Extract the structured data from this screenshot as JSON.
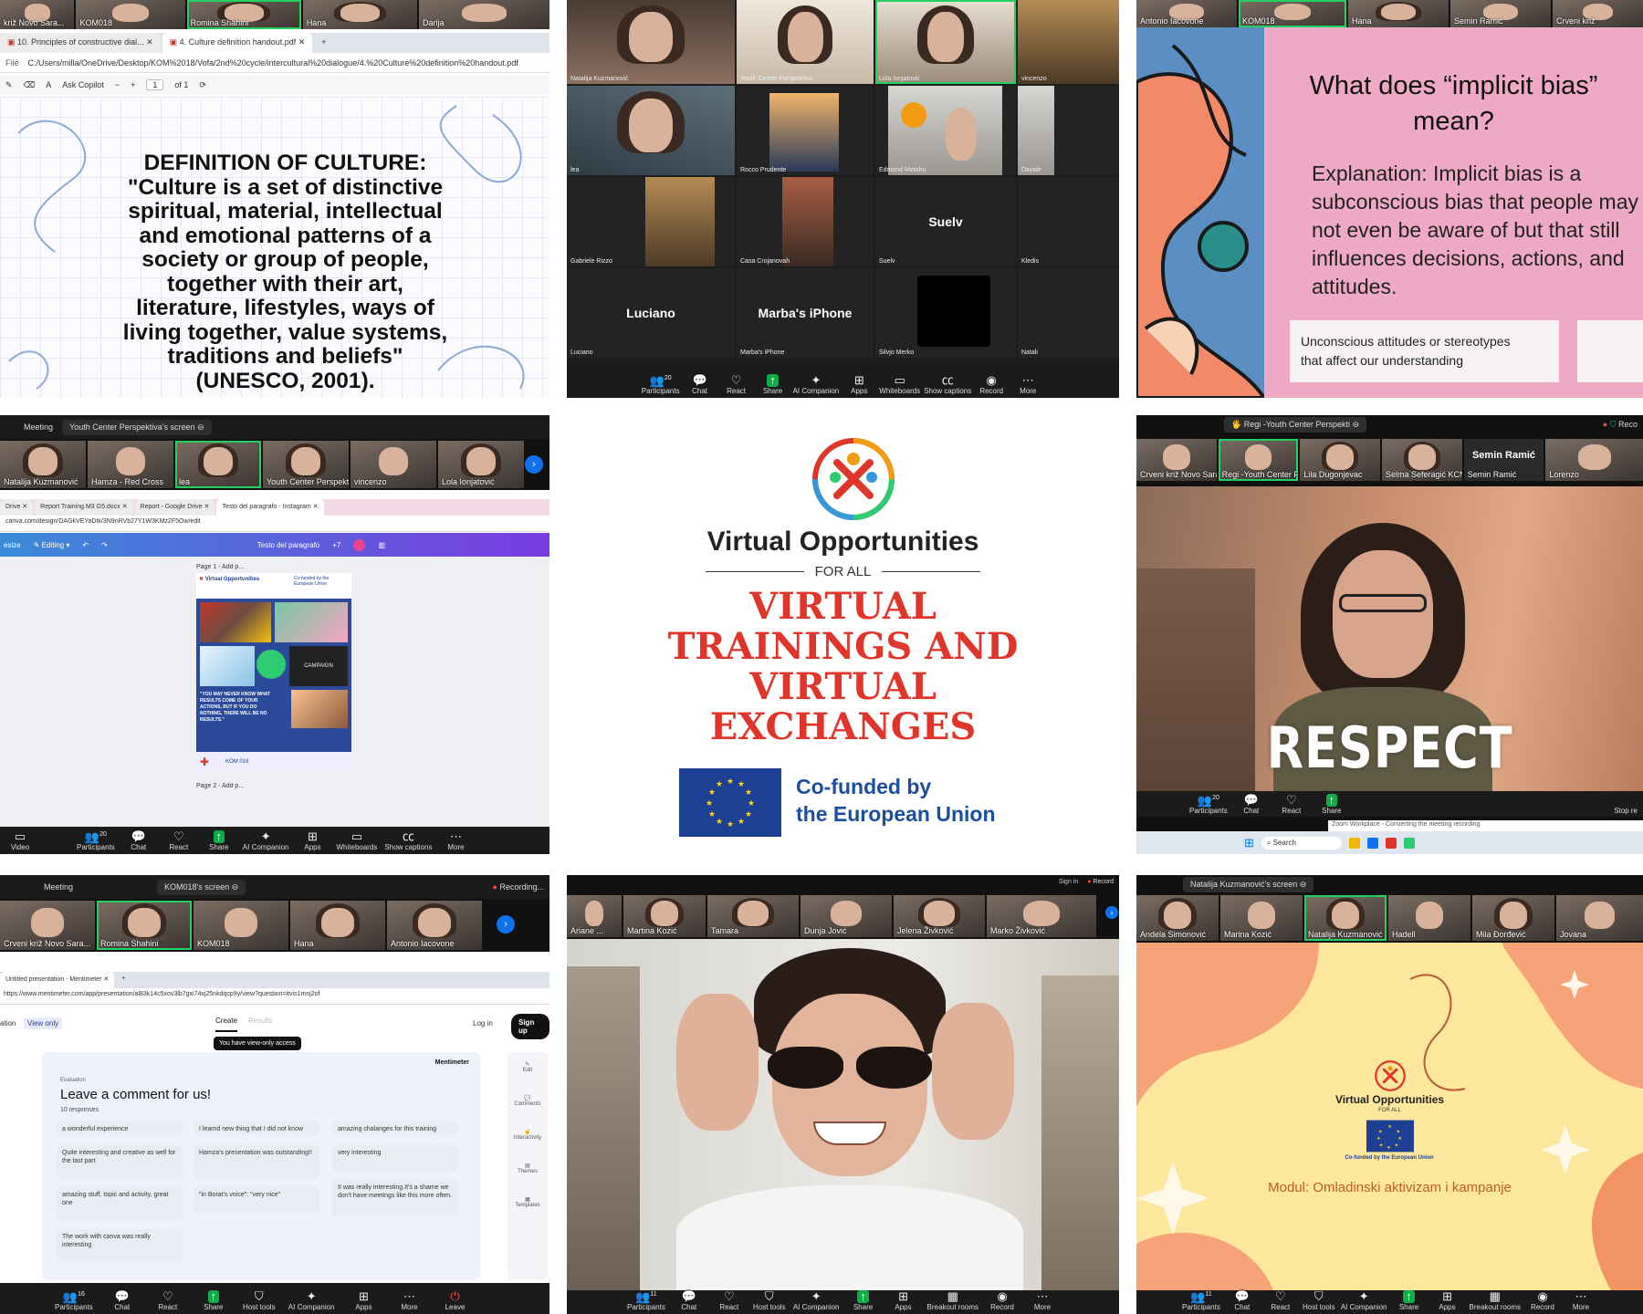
{
  "t1": {
    "participants": [
      "križ Novo Sara...",
      "KOM018",
      "Romina Shahini",
      "Hana",
      "Darija"
    ],
    "tabs": [
      "10. Principles of constructive dial...",
      "4. Culture definition handout.pdf"
    ],
    "address_label": "File",
    "address": "C:/Users/milla/OneDrive/Desktop/KOM%2018/Vofa/2nd%20cycle/intercultural%20dialogue/4.%20Culture%20definition%20handout.pdf",
    "toolbar": {
      "copilot": "Ask Copilot",
      "page": "1",
      "of": "of 1",
      "minus": "−",
      "plus": "+"
    },
    "slide_lines": [
      "DEFINITION OF CULTURE:",
      "\"Culture is a set of distinctive",
      "spiritual, material, intellectual",
      "and emotional patterns of a",
      "society or group of people,",
      "together with their art,",
      "literature, lifestyles, ways of",
      "living together, value systems,",
      "traditions and beliefs\"",
      "(UNESCO, 2001)."
    ]
  },
  "t2": {
    "cells": [
      "Natalija Kuzmanović",
      "Youth Center Perspektiva",
      "Lola Ionjatović",
      "vincenzo",
      "lea",
      "Rocco Prudente",
      "Edmond Metohu",
      "Davide",
      "Gabriele Rizzo",
      "Casa Crojanovah",
      "Suelv",
      "Kledis",
      "Luciano",
      "Marba's iPhone",
      "Silvjo Merko",
      "Natali"
    ],
    "big": {
      "suelv": "Suelv",
      "luciano": "Luciano",
      "marba": "Marba's iPhone"
    },
    "count": "20",
    "bar": [
      "Participants",
      "Chat",
      "React",
      "Share",
      "AI Companion",
      "Apps",
      "Whiteboards",
      "Show captions",
      "Record",
      "More"
    ]
  },
  "t3": {
    "participants": [
      "Antonio Iacovone",
      "KOM018",
      "Hana",
      "Semin Ramić",
      "Crveni križ"
    ],
    "title_lines": [
      "What does “implicit bias”",
      "mean?"
    ],
    "explanation_lines": [
      "Explanation: Implicit bias is a",
      "subconscious bias that people may",
      "not even be aware of but that still",
      "influences decisions, actions, and",
      "attitudes."
    ],
    "card_lines": [
      "Unconscious attitudes or stereotypes",
      "that affect our understanding"
    ]
  },
  "t4": {
    "header": {
      "meeting": "Meeting",
      "screen": "Youth Center Perspektiva's screen"
    },
    "participants": [
      "Natalija Kuzmanović",
      "Hamza - Red Cross",
      "lea",
      "Youth Center Perspekti...",
      "vincenzo",
      "Lola Ionjatović"
    ],
    "tabs": [
      "Drive",
      "Report Training M3 G5.docx",
      "Report - Google Drive",
      "Testo del paragrafo - Instagram"
    ],
    "address": "canva.com/design/DAGkVEYaDtk/3N9nRVb27Y1W3KMz2F5Ow/edit",
    "editor": {
      "resize": "esize",
      "editing": "Editing",
      "text": "Testo del paragrafo",
      "more": "+7"
    },
    "page1": "Page 1 - Add p...",
    "page2": "Page 2 - Add p...",
    "poster": {
      "title": "Virtual Opportunities",
      "eu": "Co-funded by the European Union",
      "quote": "\"YOU MAY NEVER KNOW WHAT RESULTS COME OF YOUR ACTIONS, BUT IF YOU DO NOTHING, THERE WILL BE NO RESULTS.\"",
      "campaign": "CAMPAIGN",
      "logos": "KOM 018"
    },
    "count": "20",
    "bar": [
      "Video",
      "Participants",
      "Chat",
      "React",
      "Share",
      "AI Companion",
      "Apps",
      "Whiteboards",
      "Show captions",
      "More"
    ]
  },
  "t5": {
    "title": "Virtual Opportunities",
    "subtitle": "FOR ALL",
    "headline": [
      "VIRTUAL",
      "TRAININGS AND",
      "VIRTUAL",
      "EXCHANGES"
    ],
    "eu_lines": [
      "Co-funded by",
      "the European Union"
    ]
  },
  "t6": {
    "screen": "Regi -Youth Center Perspekti",
    "rec": "Reco",
    "participants": [
      "Crveni križ Novo Sara...",
      "Regi -Youth Center Perspe...",
      "Lila Dugonjevac",
      "Selma Seferagić KCNS",
      "Semin Ramić",
      "Lorenzo"
    ],
    "big_name": "Semin Ramić",
    "overlay": "RESPECT",
    "count": "20",
    "bar": [
      "Participants",
      "Chat",
      "React",
      "Share"
    ],
    "notification": "Zoom Workplace - Converting the meeting recording",
    "stop": "Stop re",
    "search": "Search"
  },
  "t7": {
    "header": {
      "meeting": "Meeting",
      "screen": "KOM018's screen",
      "rec": "Recording..."
    },
    "participants": [
      "Crveni križ Novo Sara...",
      "Romina Shahini",
      "KOM018",
      "Hana",
      "Antonio Iacovone"
    ],
    "tab": "Untitled presentation - Mentimeter",
    "address": "https://www.mentimeter.com/app/presentation/al83k14c5xov3lb7gxi74xj25nkdqcp9y/view?question=itvis1mnj2of",
    "nav": {
      "left": "ation",
      "viewonly": "View only",
      "create": "Create",
      "results": "Results",
      "login": "Log in",
      "signup": "Sign up"
    },
    "tooltip": "You have view-only access",
    "brand": "Mentimeter",
    "eval": "Evaluation",
    "question": "Leave a comment for us!",
    "responses": "10 responses",
    "comments": [
      "a wonderful experience",
      "I learnd new thing that I did not know",
      "amazing chalanges for this training",
      "Quite interesting and creative as well for the last part",
      "Hamza's presentation was outstanding!!",
      "very interesting",
      "amazing stuff, topic and activity, great one",
      "\"in Borat's voice\": \"very nice\"",
      "It was really interesting.It's a shame we don't have meetings like this more often.",
      "The work with canva was really interesting"
    ],
    "side": [
      "Edit",
      "Comments",
      "Interactivity",
      "Themes",
      "Templates"
    ],
    "count": "16",
    "bar": [
      "Participants",
      "Chat",
      "React",
      "Share",
      "Host tools",
      "AI Companion",
      "Apps",
      "More",
      "Leave"
    ]
  },
  "t8": {
    "top": {
      "signin": "Sign in",
      "rec": "Record"
    },
    "participants": [
      "Ariane ...",
      "Martina Kozić",
      "Tamara",
      "Dunja Jović",
      "Jelena Živković",
      "Marko Živković"
    ],
    "count": "11",
    "bar": [
      "Participants",
      "Chat",
      "React",
      "Host tools",
      "AI Companion",
      "Share",
      "Apps",
      "Breakout rooms",
      "Record",
      "More"
    ]
  },
  "t9": {
    "screen": "Natalija Kuzmanović's screen",
    "participants": [
      "Andela Simonović",
      "Marina Kozić",
      "Natalija Kuzmanović",
      "Hadell",
      "Mila Đorđević",
      "Jovana"
    ],
    "logo_title": "Virtual Opportunities",
    "logo_sub": "FOR ALL",
    "eu": "Co-funded by the European Union",
    "module": "Modul: Omladinski aktivizam i kampanje",
    "count": "11",
    "bar": [
      "Participants",
      "Chat",
      "React",
      "Host tools",
      "AI Companion",
      "Share",
      "Apps",
      "Breakout rooms",
      "Record",
      "More"
    ]
  },
  "colors": {
    "zoom_green": "#0ead47",
    "zoom_blue": "#0e72ed",
    "headline_red": "#e0352b",
    "eu_blue": "#1d3f94",
    "pink_slide": "#eea9c4"
  },
  "icons": [
    "participants-icon",
    "chat-icon",
    "react-icon",
    "share-icon",
    "ai-companion-icon",
    "apps-icon",
    "whiteboards-icon",
    "captions-icon",
    "record-icon",
    "more-icon",
    "video-icon",
    "host-tools-icon",
    "leave-icon",
    "shield-icon",
    "search-icon"
  ]
}
